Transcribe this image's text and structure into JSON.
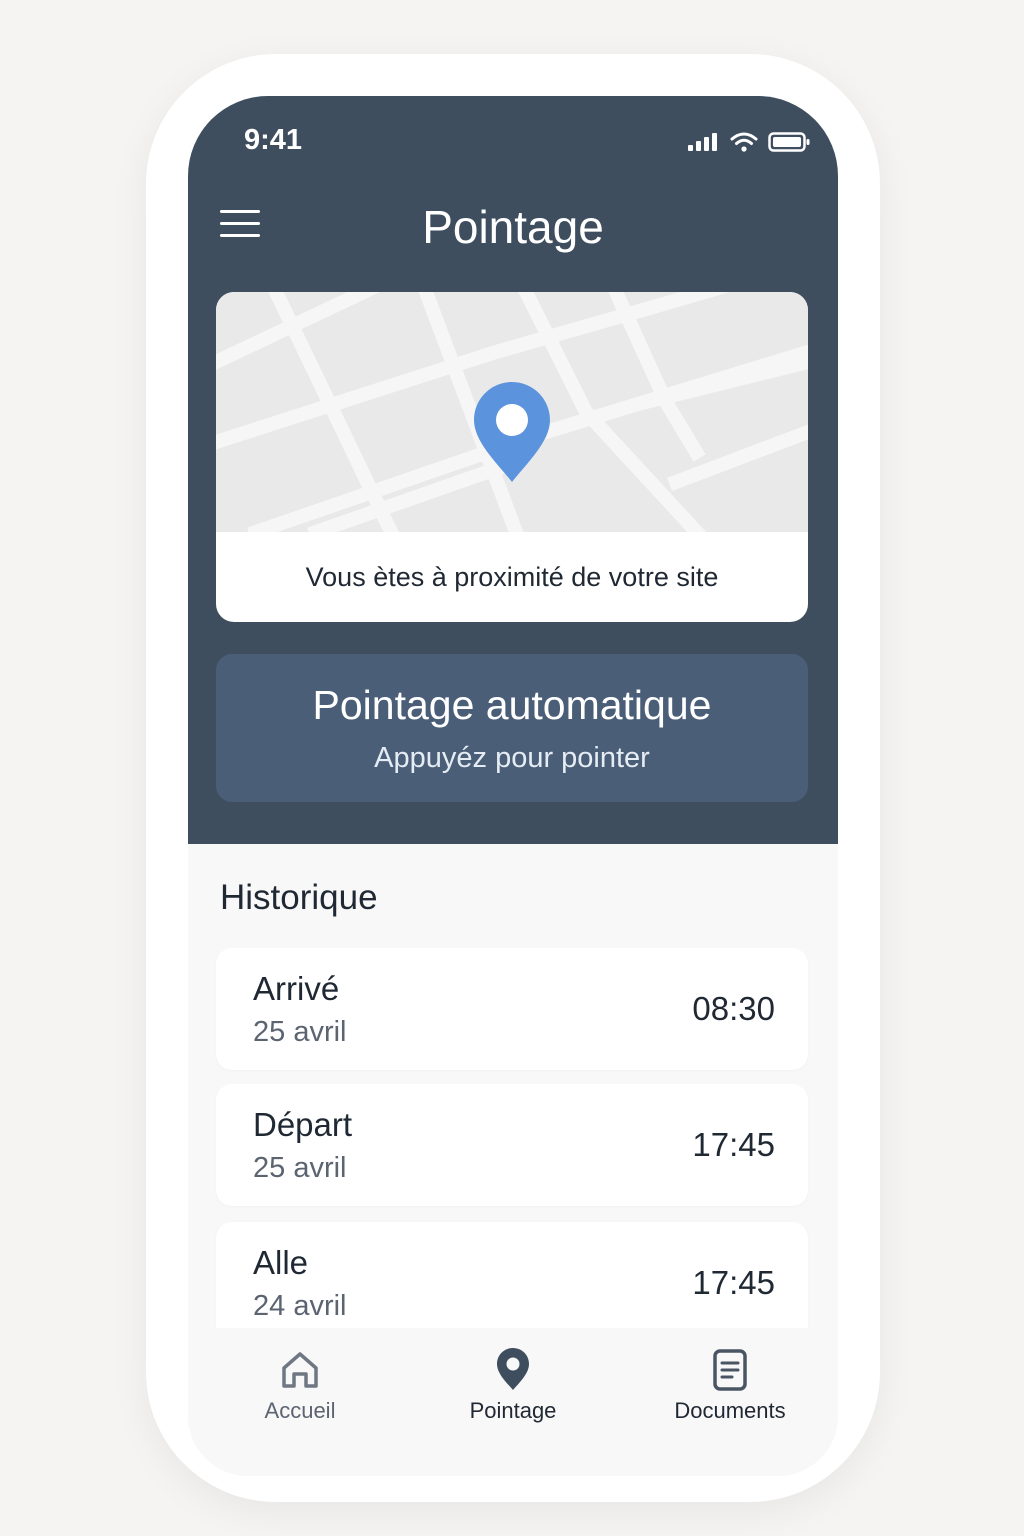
{
  "status_bar": {
    "time": "9:41",
    "icons": [
      "signal-icon",
      "wifi-icon",
      "battery-icon"
    ]
  },
  "header": {
    "title": "Pointage",
    "menu_icon": "menu-icon"
  },
  "map_card": {
    "pin_icon": "map-pin-icon",
    "caption": "Vous ètes à proximité de votre site"
  },
  "auto_button": {
    "title": "Pointage automatique",
    "subtitle": "Appuyéz pour pointer"
  },
  "history": {
    "title": "Historique",
    "items": [
      {
        "label": "Arrivé",
        "date": "25 avril",
        "time": "08:30"
      },
      {
        "label": "Départ",
        "date": "25 avril",
        "time": "17:45"
      },
      {
        "label": "Alle",
        "date": "24 avril",
        "time": "17:45"
      }
    ]
  },
  "tabbar": {
    "tabs": [
      {
        "label": "Accueil",
        "icon": "home-icon"
      },
      {
        "label": "Pointage",
        "icon": "map-pin-icon"
      },
      {
        "label": "Documents",
        "icon": "document-icon"
      }
    ]
  },
  "colors": {
    "header_bg": "#3e4e5f",
    "button_bg": "#4a5e78",
    "pin": "#5b93dc",
    "screen_bg": "#f8f8f9"
  }
}
